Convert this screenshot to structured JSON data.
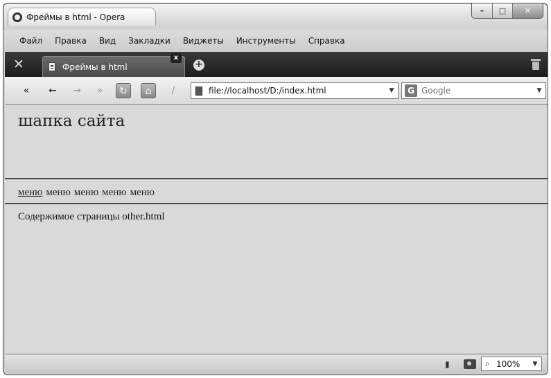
{
  "window": {
    "title": "Фреймы в html - Opera",
    "controls": {
      "minimize": "–",
      "maximize": "□",
      "close": "✕"
    }
  },
  "menubar": {
    "items": [
      "Файл",
      "Правка",
      "Вид",
      "Закладки",
      "Виджеты",
      "Инструменты",
      "Справка"
    ]
  },
  "tabs": {
    "active": {
      "label": "Фреймы в html",
      "close": "x"
    },
    "new_tab": "+"
  },
  "toolbar": {
    "rewind": "«",
    "back": "←",
    "forward": "→",
    "fast_forward": "»",
    "reload": "↻",
    "home": "⌂",
    "edit": "/",
    "address": "file://localhost/D:/index.html",
    "search_placeholder": "Google",
    "search_icon": "G"
  },
  "page": {
    "header_text": "шапка сайта",
    "menu_link": "меню",
    "menu_plain": [
      "меню",
      "меню",
      "меню",
      "меню"
    ],
    "main_text": "Содержимое страницы other.html"
  },
  "statusbar": {
    "zoom": "100%"
  },
  "icons": {
    "tools": "tools-icon",
    "trash": "trash-icon",
    "camera": "camera-icon",
    "turbo": "turbo-icon",
    "magnifier": "magnifier-icon"
  }
}
